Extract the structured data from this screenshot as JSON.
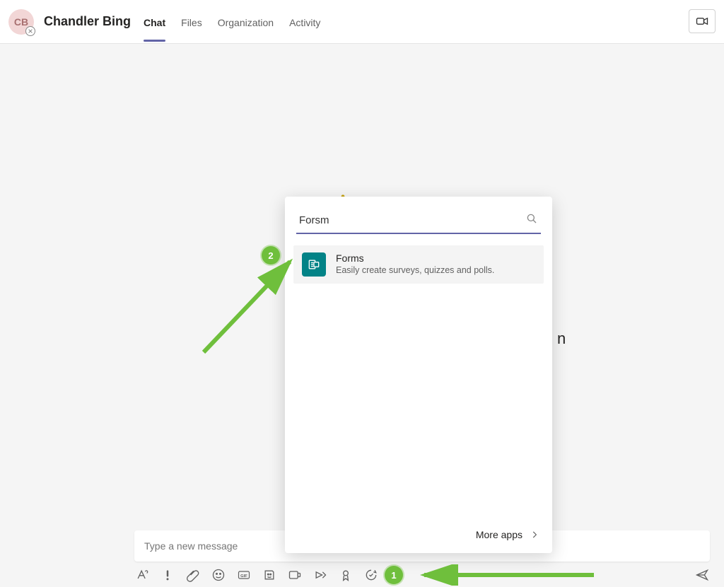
{
  "header": {
    "avatar_initials": "CB",
    "title": "Chandler Bing",
    "tabs": [
      {
        "label": "Chat",
        "active": true
      },
      {
        "label": "Files",
        "active": false
      },
      {
        "label": "Organization",
        "active": false
      },
      {
        "label": "Activity",
        "active": false
      }
    ]
  },
  "compose": {
    "placeholder": "Type a new message"
  },
  "app_picker": {
    "search_value": "Forsm",
    "result": {
      "title": "Forms",
      "subtitle": "Easily create surveys, quizzes and polls."
    },
    "more_apps_label": "More apps"
  },
  "annotations": {
    "callout1": "1",
    "callout2": "2"
  },
  "background_hints": {
    "right_char": "n"
  },
  "toolbar_icons": [
    "format-icon",
    "priority-icon",
    "attach-icon",
    "emoji-icon",
    "gif-icon",
    "sticker-icon",
    "meet-now-icon",
    "stream-icon",
    "praise-icon",
    "approvals-icon",
    "more-icon"
  ],
  "colors": {
    "accent": "#6264a7",
    "annotation": "#6fbf3c",
    "forms_app": "#038387"
  }
}
